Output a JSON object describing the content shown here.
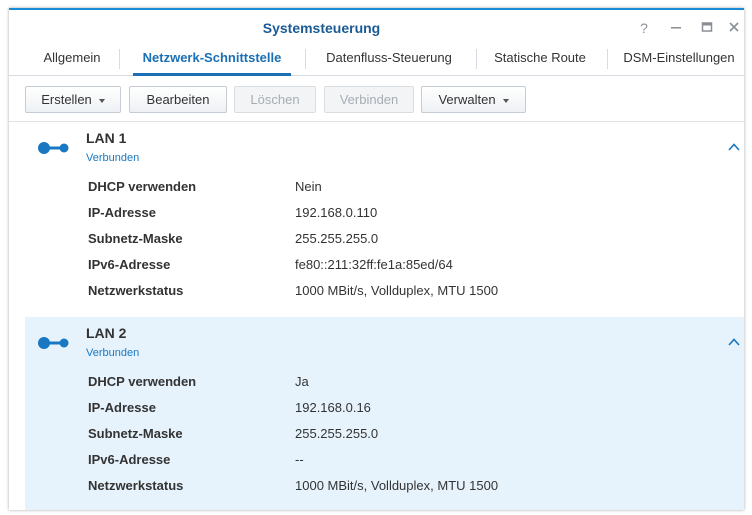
{
  "window": {
    "title": "Systemsteuerung",
    "controls": {
      "help": "?",
      "minimize": "—",
      "maximize": "▭",
      "close": "✕"
    }
  },
  "tabs": [
    {
      "label": "Allgemein",
      "active": false
    },
    {
      "label": "Netzwerk-Schnittstelle",
      "active": true
    },
    {
      "label": "Datenfluss-Steuerung",
      "active": false
    },
    {
      "label": "Statische Route",
      "active": false
    },
    {
      "label": "DSM-Einstellungen",
      "active": false
    }
  ],
  "toolbar": {
    "create": "Erstellen",
    "edit": "Bearbeiten",
    "delete": "Löschen",
    "connect": "Verbinden",
    "manage": "Verwalten"
  },
  "interfaces": [
    {
      "name": "LAN 1",
      "status": "Verbunden",
      "selected": false,
      "rows": [
        {
          "label": "DHCP verwenden",
          "value": "Nein"
        },
        {
          "label": "IP-Adresse",
          "value": "192.168.0.110"
        },
        {
          "label": "Subnetz-Maske",
          "value": "255.255.255.0"
        },
        {
          "label": "IPv6-Adresse",
          "value": "fe80::211:32ff:fe1a:85ed/64"
        },
        {
          "label": "Netzwerkstatus",
          "value": "1000 MBit/s, Vollduplex, MTU 1500"
        }
      ]
    },
    {
      "name": "LAN 2",
      "status": "Verbunden",
      "selected": true,
      "rows": [
        {
          "label": "DHCP verwenden",
          "value": "Ja"
        },
        {
          "label": "IP-Adresse",
          "value": "192.168.0.16"
        },
        {
          "label": "Subnetz-Maske",
          "value": "255.255.255.0"
        },
        {
          "label": "IPv6-Adresse",
          "value": "--"
        },
        {
          "label": "Netzwerkstatus",
          "value": "1000 MBit/s, Vollduplex, MTU 1500"
        }
      ]
    }
  ],
  "colors": {
    "accent": "#1a6fb5",
    "title": "#1a5b96",
    "selected_bg": "#e6f3fc",
    "status_link": "#1a78c2"
  },
  "icons": {
    "interface": "lan-connection-icon",
    "collapse": "chevron-up-icon"
  }
}
